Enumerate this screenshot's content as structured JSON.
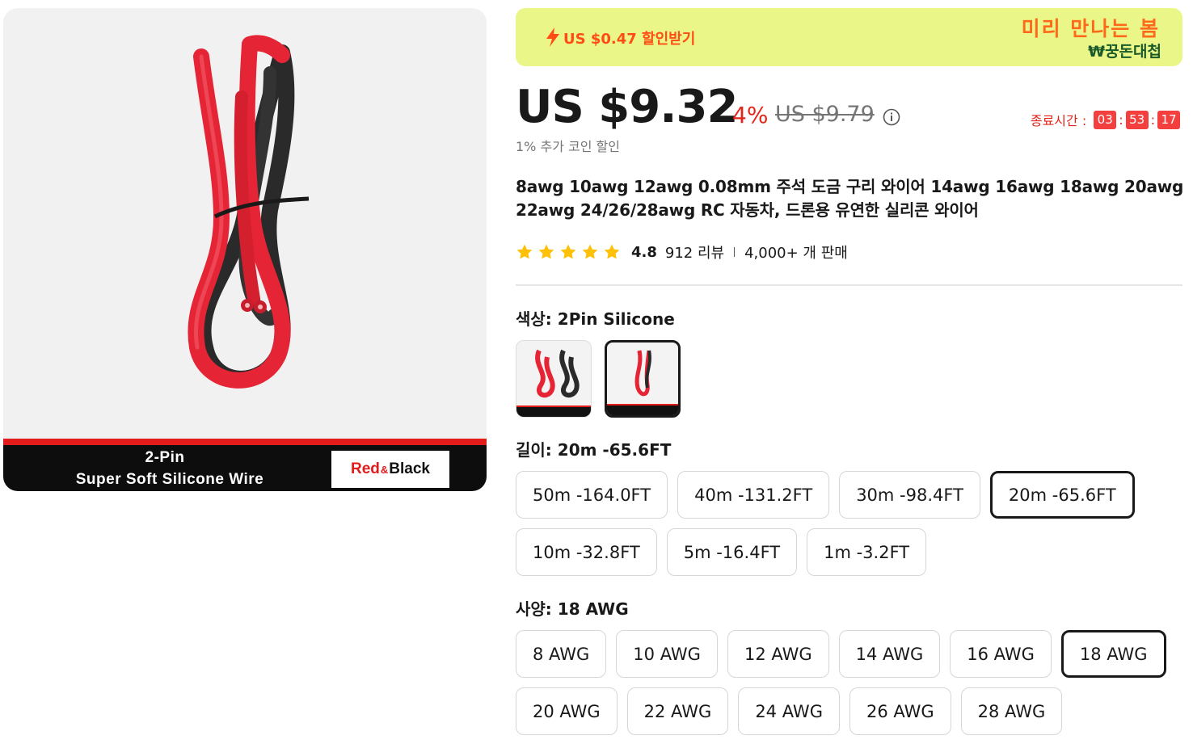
{
  "gallery": {
    "band_title": "2-Pin",
    "band_subtitle": "Super Soft Silicone Wire",
    "tag_red": "Red",
    "tag_amp": "&",
    "tag_black": "Black"
  },
  "promo": {
    "coupon_text": "US $0.47 할인받기",
    "campaign_title": "미리 만나는 봄",
    "campaign_subtitle": "₩꿍돈대첩"
  },
  "price": {
    "current": "US $9.32",
    "discount": "4%",
    "original": "US $9.79",
    "coin_note": "1% 추가 코인 할인"
  },
  "timer": {
    "label": "종료시간 :",
    "hours": "03",
    "minutes": "53",
    "seconds": "17",
    "sep": ":"
  },
  "product": {
    "title": "8awg 10awg 12awg 0.08mm 주석 도금 구리 와이어 14awg 16awg 18awg 20awg 22awg 24/26/28awg RC 자동차, 드론용 유연한 실리콘 와이어",
    "rating": "4.8",
    "stars": 5,
    "reviews": "912 리뷰",
    "sold": "4,000+ 개 판매"
  },
  "color_option": {
    "label": "색상:",
    "value": "2Pin Silicone",
    "swatches": [
      {
        "name": "Red & Black set",
        "selected": false
      },
      {
        "name": "2Pin Silicone",
        "selected": true
      }
    ]
  },
  "length_option": {
    "label": "길이:",
    "value": "20m -65.6FT",
    "options": [
      {
        "label": "50m -164.0FT",
        "selected": false
      },
      {
        "label": "40m -131.2FT",
        "selected": false
      },
      {
        "label": "30m -98.4FT",
        "selected": false
      },
      {
        "label": "20m -65.6FT",
        "selected": true
      },
      {
        "label": "10m -32.8FT",
        "selected": false
      },
      {
        "label": "5m -16.4FT",
        "selected": false
      },
      {
        "label": "1m -3.2FT",
        "selected": false
      }
    ]
  },
  "spec_option": {
    "label": "사양:",
    "value": "18 AWG",
    "options": [
      {
        "label": "8 AWG",
        "selected": false
      },
      {
        "label": "10 AWG",
        "selected": false
      },
      {
        "label": "12 AWG",
        "selected": false
      },
      {
        "label": "14 AWG",
        "selected": false
      },
      {
        "label": "16 AWG",
        "selected": false
      },
      {
        "label": "18 AWG",
        "selected": true
      },
      {
        "label": "20 AWG",
        "selected": false
      },
      {
        "label": "22 AWG",
        "selected": false
      },
      {
        "label": "24 AWG",
        "selected": false
      },
      {
        "label": "26 AWG",
        "selected": false
      },
      {
        "label": "28 AWG",
        "selected": false
      }
    ]
  },
  "colors": {
    "price_red": "#e1251b",
    "promo_bg": "#eaf788",
    "coupon_orange": "#ff4c14",
    "star_gold": "#ffc107"
  }
}
